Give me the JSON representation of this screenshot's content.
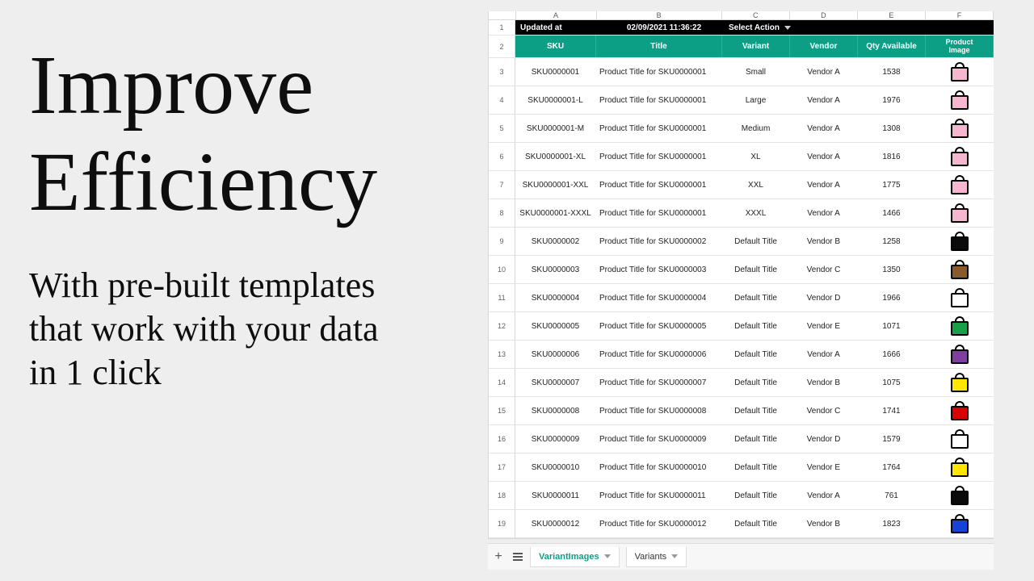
{
  "headline_line1": "Improve",
  "headline_line2": "Efficiency",
  "subhead": "With pre-built templates that work with your data in 1 click",
  "columns": {
    "a": "A",
    "b": "B",
    "c": "C",
    "d": "D",
    "e": "E",
    "f": "F"
  },
  "action_row": {
    "label": "Updated at",
    "timestamp": "02/09/2021 11:36:22",
    "action": "Select Action"
  },
  "headers": {
    "sku": "SKU",
    "title": "Title",
    "variant": "Variant",
    "vendor": "Vendor",
    "qty": "Qty Available",
    "img1": "Product",
    "img2": "Image"
  },
  "rows": [
    {
      "n": 3,
      "sku": "SKU0000001",
      "title": "Product Title for SKU0000001",
      "variant": "Small",
      "vendor": "Vendor A",
      "qty": "1538",
      "color": "#f7b6cf"
    },
    {
      "n": 4,
      "sku": "SKU0000001-L",
      "title": "Product Title for SKU0000001",
      "variant": "Large",
      "vendor": "Vendor A",
      "qty": "1976",
      "color": "#f7b6cf"
    },
    {
      "n": 5,
      "sku": "SKU0000001-M",
      "title": "Product Title for SKU0000001",
      "variant": "Medium",
      "vendor": "Vendor A",
      "qty": "1308",
      "color": "#f7b6cf"
    },
    {
      "n": 6,
      "sku": "SKU0000001-XL",
      "title": "Product Title for SKU0000001",
      "variant": "XL",
      "vendor": "Vendor A",
      "qty": "1816",
      "color": "#f7b6cf"
    },
    {
      "n": 7,
      "sku": "SKU0000001-XXL",
      "title": "Product Title for SKU0000001",
      "variant": "XXL",
      "vendor": "Vendor A",
      "qty": "1775",
      "color": "#f7b6cf"
    },
    {
      "n": 8,
      "sku": "SKU0000001-XXXL",
      "title": "Product Title for SKU0000001",
      "variant": "XXXL",
      "vendor": "Vendor A",
      "qty": "1466",
      "color": "#f7b6cf"
    },
    {
      "n": 9,
      "sku": "SKU0000002",
      "title": "Product Title for SKU0000002",
      "variant": "Default Title",
      "vendor": "Vendor B",
      "qty": "1258",
      "color": "#0a0a0a"
    },
    {
      "n": 10,
      "sku": "SKU0000003",
      "title": "Product Title for SKU0000003",
      "variant": "Default Title",
      "vendor": "Vendor C",
      "qty": "1350",
      "color": "#8a5a2b"
    },
    {
      "n": 11,
      "sku": "SKU0000004",
      "title": "Product Title for SKU0000004",
      "variant": "Default Title",
      "vendor": "Vendor D",
      "qty": "1966",
      "color": "#ffffff"
    },
    {
      "n": 12,
      "sku": "SKU0000005",
      "title": "Product Title for SKU0000005",
      "variant": "Default Title",
      "vendor": "Vendor E",
      "qty": "1071",
      "color": "#18a048"
    },
    {
      "n": 13,
      "sku": "SKU0000006",
      "title": "Product Title for SKU0000006",
      "variant": "Default Title",
      "vendor": "Vendor A",
      "qty": "1666",
      "color": "#7e3fa0"
    },
    {
      "n": 14,
      "sku": "SKU0000007",
      "title": "Product Title for SKU0000007",
      "variant": "Default Title",
      "vendor": "Vendor B",
      "qty": "1075",
      "color": "#ffe600"
    },
    {
      "n": 15,
      "sku": "SKU0000008",
      "title": "Product Title for SKU0000008",
      "variant": "Default Title",
      "vendor": "Vendor C",
      "qty": "1741",
      "color": "#d90000"
    },
    {
      "n": 16,
      "sku": "SKU0000009",
      "title": "Product Title for SKU0000009",
      "variant": "Default Title",
      "vendor": "Vendor D",
      "qty": "1579",
      "color": "#ffffff"
    },
    {
      "n": 17,
      "sku": "SKU0000010",
      "title": "Product Title for SKU0000010",
      "variant": "Default Title",
      "vendor": "Vendor E",
      "qty": "1764",
      "color": "#ffe600"
    },
    {
      "n": 18,
      "sku": "SKU0000011",
      "title": "Product Title for SKU0000011",
      "variant": "Default Title",
      "vendor": "Vendor A",
      "qty": "761",
      "color": "#0a0a0a"
    },
    {
      "n": 19,
      "sku": "SKU0000012",
      "title": "Product Title for SKU0000012",
      "variant": "Default Title",
      "vendor": "Vendor B",
      "qty": "1823",
      "color": "#1543d8"
    }
  ],
  "tabs": {
    "add": "+",
    "active": "VariantImages",
    "other": "Variants"
  }
}
